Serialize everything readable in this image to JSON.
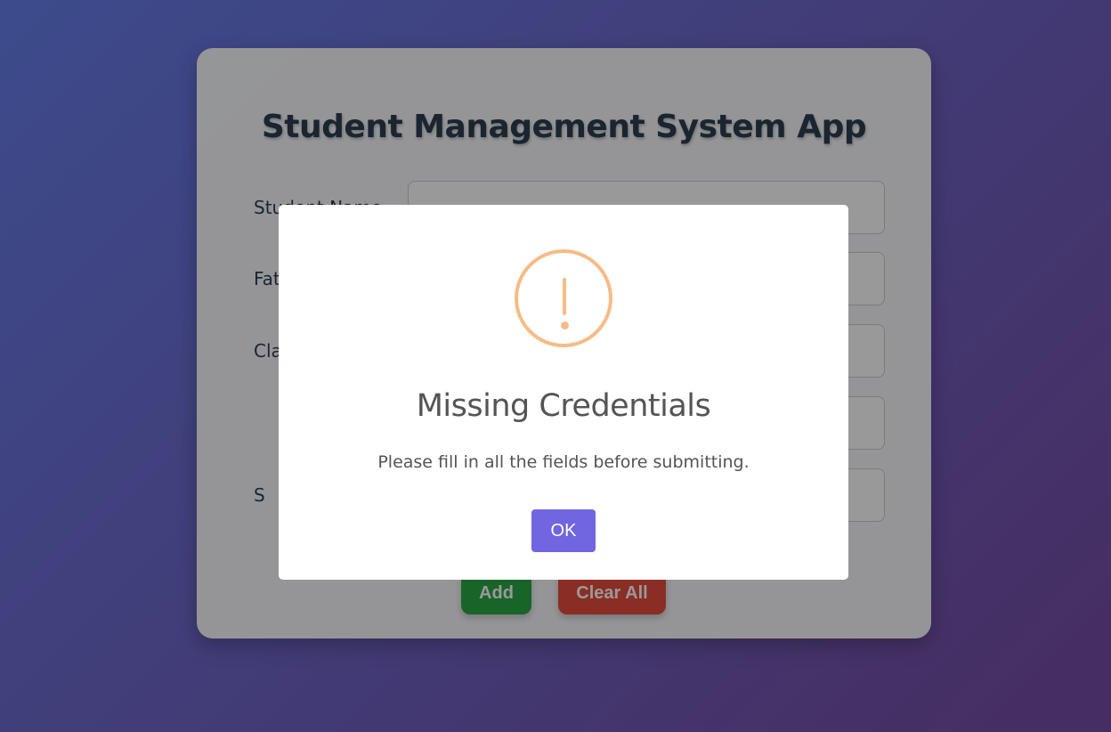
{
  "app": {
    "title": "Student Management System App",
    "fields": [
      {
        "label": "Student Name",
        "value": ""
      },
      {
        "label": "Father Name",
        "value": ""
      },
      {
        "label": "Class",
        "value": ""
      },
      {
        "label": "",
        "value": ""
      },
      {
        "label": "S",
        "value": ""
      }
    ],
    "add_label": "Add",
    "clear_label": "Clear All"
  },
  "modal": {
    "icon": "warning-icon",
    "icon_color": "#f8bb86",
    "title": "Missing Credentials",
    "text": "Please fill in all the fields before submitting.",
    "ok_label": "OK",
    "ok_color": "#7066e0"
  }
}
